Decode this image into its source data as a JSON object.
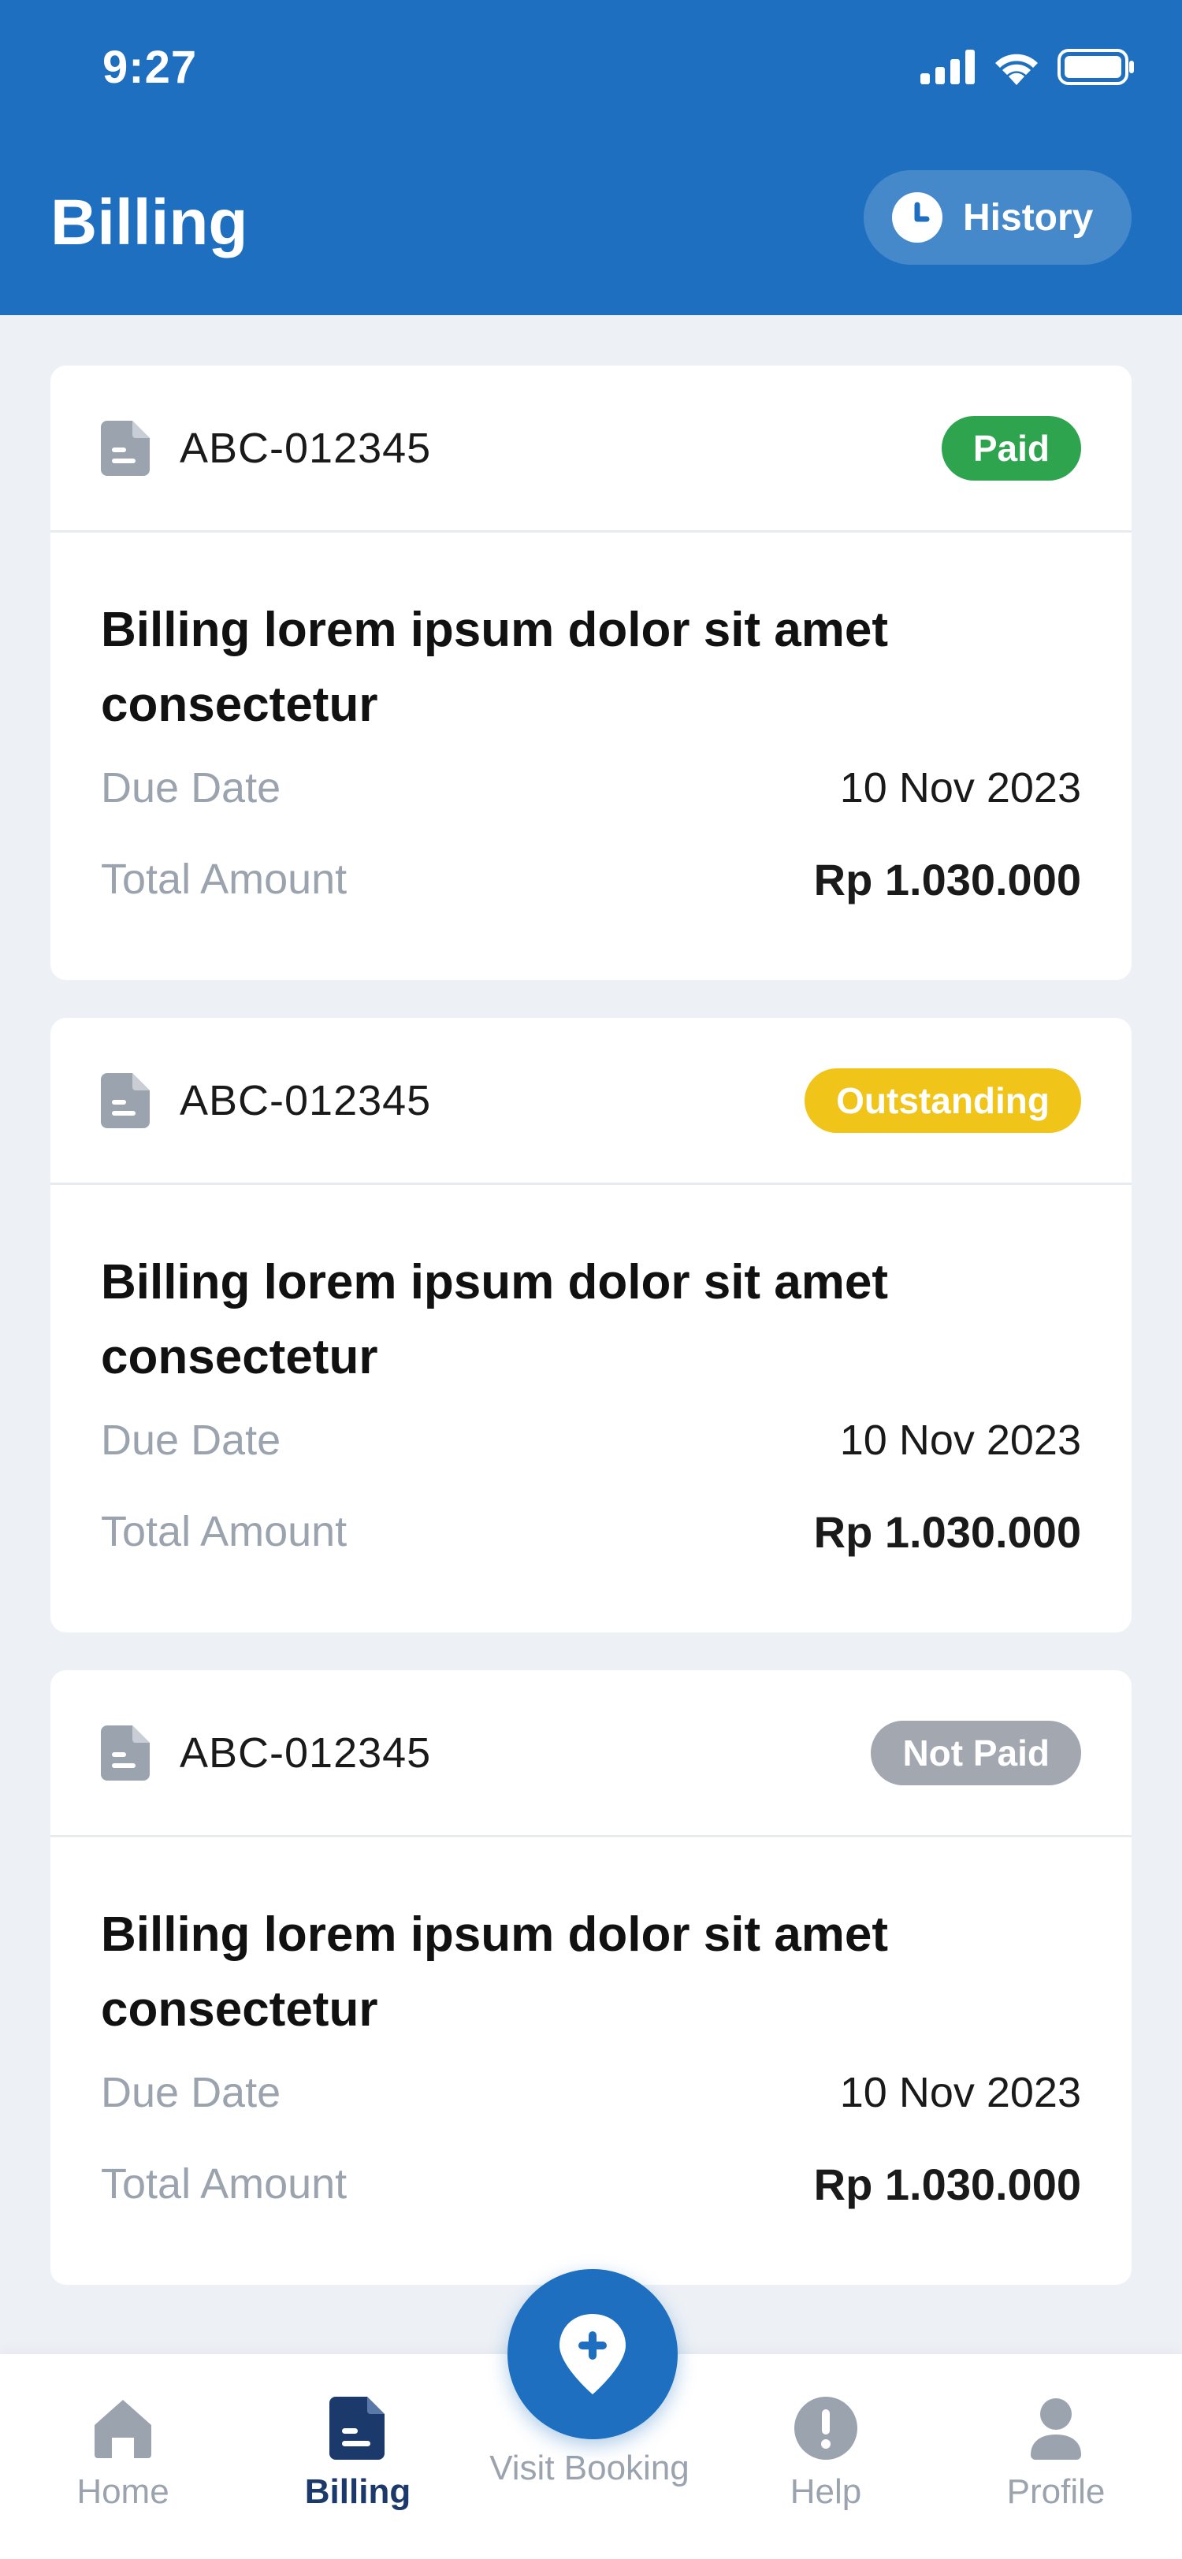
{
  "status_bar": {
    "time": "9:27"
  },
  "header": {
    "title": "Billing",
    "history_label": "History"
  },
  "bills": [
    {
      "id": "ABC-012345",
      "status": "Paid",
      "status_color": "#2ea44f",
      "title": "Billing lorem ipsum dolor sit amet consectetur",
      "due_date_label": "Due Date",
      "due_date": "10 Nov 2023",
      "total_label": "Total Amount",
      "total": "Rp 1.030.000"
    },
    {
      "id": "ABC-012345",
      "status": "Outstanding",
      "status_color": "#f0c419",
      "title": "Billing lorem ipsum dolor sit amet consectetur",
      "due_date_label": "Due Date",
      "due_date": "10 Nov 2023",
      "total_label": "Total Amount",
      "total": "Rp 1.030.000"
    },
    {
      "id": "ABC-012345",
      "status": "Not Paid",
      "status_color": "#a3a8b0",
      "title": "Billing lorem ipsum dolor sit amet consectetur",
      "due_date_label": "Due Date",
      "due_date": "10 Nov 2023",
      "total_label": "Total Amount",
      "total": "Rp 1.030.000"
    }
  ],
  "bottom_nav": {
    "items": [
      {
        "label": "Home",
        "icon": "home-icon"
      },
      {
        "label": "Billing",
        "icon": "billing-icon",
        "active": true
      },
      {
        "label": "Visit Booking",
        "icon": "location-plus-icon"
      },
      {
        "label": "Help",
        "icon": "exclamation-icon"
      },
      {
        "label": "Profile",
        "icon": "user-icon"
      }
    ]
  },
  "colors": {
    "primary": "#1e6fbf",
    "active_nav": "#1b3a6b",
    "muted": "#9aa3ae",
    "background": "#edf1f6"
  }
}
